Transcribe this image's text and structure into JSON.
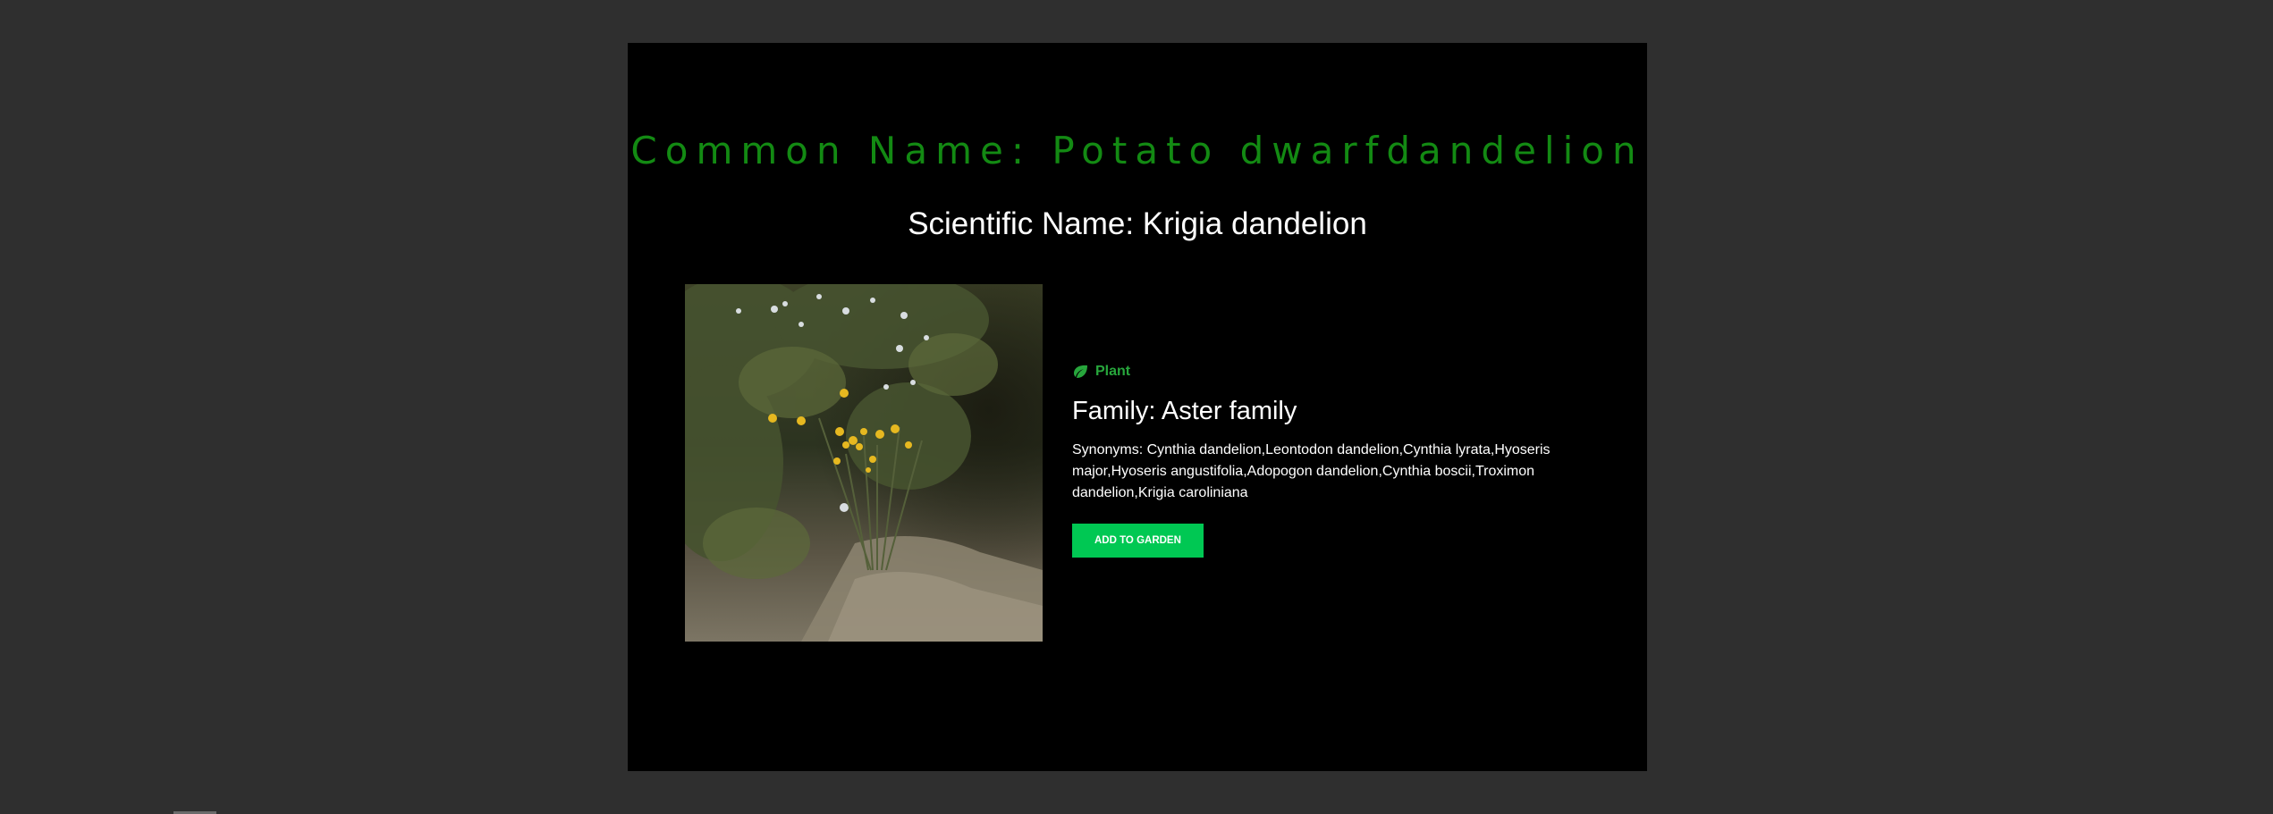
{
  "plant": {
    "common_name": "Common Name: Potato dwarfdandelion",
    "scientific_name": "Scientific Name: Krigia dandelion",
    "photo_alt": "",
    "category": "Plant",
    "family": "Family: Aster family",
    "synonyms": "Synonyms: Cynthia dandelion,Leontodon dandelion,Cynthia lyrata,Hyoseris major,Hyoseris angustifolia,Adopogon dandelion,Cynthia boscii,Troximon dandelion,Krigia caroliniana",
    "add_button_label": "ADD TO GARDEN"
  },
  "icons": {
    "category_icon": "leaf-icon"
  },
  "colors": {
    "page_background": "#2f2f2f",
    "card_background": "#000000",
    "common_name": "#138a13",
    "accent": "#27a63c",
    "button": "#00c853"
  }
}
